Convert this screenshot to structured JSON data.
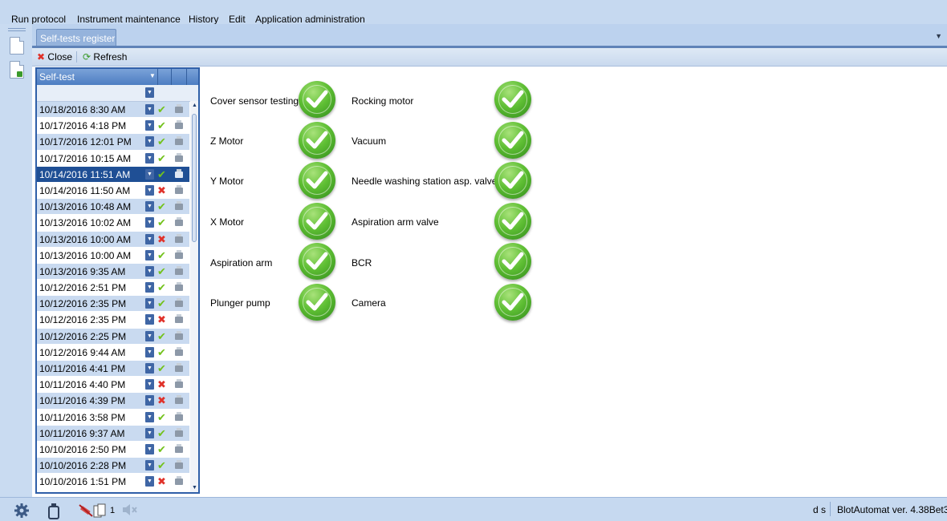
{
  "menu": {
    "items": [
      "Run protocol",
      "Instrument maintenance",
      "History",
      "Edit",
      "Application administration"
    ]
  },
  "tab": {
    "label": "Self-tests register"
  },
  "toolbar": {
    "close_label": "Close",
    "refresh_label": "Refresh"
  },
  "grid": {
    "header": "Self-test",
    "rows": [
      {
        "date": "10/18/2016 8:30 AM",
        "status": "pass"
      },
      {
        "date": "10/17/2016 4:18 PM",
        "status": "pass"
      },
      {
        "date": "10/17/2016 12:01 PM",
        "status": "pass"
      },
      {
        "date": "10/17/2016 10:15 AM",
        "status": "pass"
      },
      {
        "date": "10/14/2016 11:51 AM",
        "status": "pass",
        "selected": true
      },
      {
        "date": "10/14/2016 11:50 AM",
        "status": "fail"
      },
      {
        "date": "10/13/2016 10:48 AM",
        "status": "pass"
      },
      {
        "date": "10/13/2016 10:02 AM",
        "status": "pass"
      },
      {
        "date": "10/13/2016 10:00 AM",
        "status": "fail"
      },
      {
        "date": "10/13/2016 10:00 AM",
        "status": "pass"
      },
      {
        "date": "10/13/2016 9:35 AM",
        "status": "pass"
      },
      {
        "date": "10/12/2016 2:51 PM",
        "status": "pass"
      },
      {
        "date": "10/12/2016 2:35 PM",
        "status": "pass"
      },
      {
        "date": "10/12/2016 2:35 PM",
        "status": "fail"
      },
      {
        "date": "10/12/2016 2:25 PM",
        "status": "pass"
      },
      {
        "date": "10/12/2016 9:44 AM",
        "status": "pass"
      },
      {
        "date": "10/11/2016 4:41 PM",
        "status": "pass"
      },
      {
        "date": "10/11/2016 4:40 PM",
        "status": "fail"
      },
      {
        "date": "10/11/2016 4:39 PM",
        "status": "fail"
      },
      {
        "date": "10/11/2016 3:58 PM",
        "status": "pass"
      },
      {
        "date": "10/11/2016 9:37 AM",
        "status": "pass"
      },
      {
        "date": "10/10/2016 2:50 PM",
        "status": "pass"
      },
      {
        "date": "10/10/2016 2:28 PM",
        "status": "pass"
      },
      {
        "date": "10/10/2016 1:51 PM",
        "status": "fail"
      }
    ]
  },
  "results": [
    {
      "name": "Cover sensor testing",
      "status": "pass"
    },
    {
      "name": "Z Motor",
      "status": "pass"
    },
    {
      "name": "Y Motor",
      "status": "pass"
    },
    {
      "name": "X Motor",
      "status": "pass"
    },
    {
      "name": "Aspiration arm",
      "status": "pass"
    },
    {
      "name": "Plunger pump",
      "status": "pass"
    },
    {
      "name": "Rocking motor",
      "status": "pass"
    },
    {
      "name": "Vacuum",
      "status": "pass"
    },
    {
      "name": "Needle washing station asp. valve",
      "status": "pass"
    },
    {
      "name": "Aspiration arm valve",
      "status": "pass"
    },
    {
      "name": "BCR",
      "status": "pass"
    },
    {
      "name": "Camera",
      "status": "pass"
    }
  ],
  "statusbar": {
    "strip_count": "1",
    "user": "d s",
    "version": "BlotAutomat ver. 4.38Bet3"
  },
  "colors": {
    "pass": "#73c21c",
    "fail": "#e0322a",
    "selected_row": "#1f4f95",
    "alt_row": "#c9daf0"
  },
  "icons": {
    "left_toolbar": [
      "document-icon",
      "document-export-icon"
    ],
    "statusbar": [
      "gear-icon",
      "bottle-icon",
      "syringe-disabled-icon",
      "strips-icon",
      "speaker-muted-icon"
    ]
  }
}
